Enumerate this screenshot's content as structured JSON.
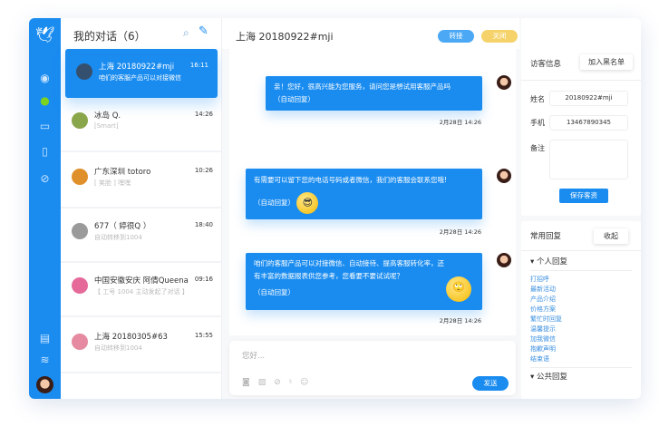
{
  "sidebar": {
    "icons": [
      "bird-logo",
      "weibo",
      "wechat",
      "monitor",
      "mobile",
      "link",
      "notes",
      "layers",
      "avatar"
    ]
  },
  "list": {
    "title": "我的对话（6）",
    "items": [
      {
        "name": "上海 20180922#mji",
        "preview": "咱们的客服产品可以对接微信",
        "time": "16:11",
        "active": true,
        "avatar_color": "#35506e"
      },
      {
        "name": "冰岛 Q.",
        "preview": "[Smart]",
        "time": "14:26",
        "avatar_color": "#8aa64a"
      },
      {
        "name": "广东深圳 totoro",
        "preview": "[ 笑脸 ] 嘿嘿",
        "time": "10:26",
        "avatar_color": "#e0902a"
      },
      {
        "name": "677（ 婷很Q ）",
        "preview": "自动转移到1004",
        "time": "18:40",
        "avatar_color": "#9a9a9a"
      },
      {
        "name": "中国安徽安庆 阿倩Queena",
        "preview": "【 工号 1004 主动发起了对话 】",
        "time": "09:16",
        "avatar_color": "#e56a9a"
      },
      {
        "name": "上海 20180305#63",
        "preview": "自动转移到1004",
        "time": "15:55",
        "avatar_color": "#e58aa0"
      }
    ]
  },
  "chat": {
    "title": "上海 20180922#mji",
    "transfer_label": "转接",
    "close_label": "关闭",
    "messages": [
      {
        "text": "亲！您好，很高兴能为您服务，请问您是想试用客服产品吗",
        "auto": "（自动回复）",
        "time": "2月28日 14:26"
      },
      {
        "text": "有需要可以留下您的电话号码或者微信，我们的客服会联系您哦!",
        "auto": "（自动回复）",
        "time": "2月28日 14:26"
      },
      {
        "text": "咱们的客服产品可以对接微信、自动接待、提高客服转化率，还有丰富的数据报表供您参考，您看要不要试试呢？",
        "auto": "（自动回复）",
        "time": "2月28日 14:26"
      }
    ],
    "input_placeholder": "您好...",
    "send_label": "发送"
  },
  "visitor": {
    "title": "访客信息",
    "blacklist_label": "加入黑名单",
    "name_label": "姓名",
    "name_value": "20180922#mji",
    "phone_label": "手机",
    "phone_value": "13467890345",
    "note_label": "备注",
    "save_label": "保存客资"
  },
  "replies": {
    "title": "常用回复",
    "collapse_label": "收起",
    "personal_label": "个人回复",
    "personal_items": [
      "打招呼",
      "最新活动",
      "产品介绍",
      "价格方案",
      "繁忙时回复",
      "温馨提示",
      "加我微信",
      "抱歉声明",
      "结束语"
    ],
    "public_label": "公共回复"
  },
  "colors": {
    "primary": "#1a8cf0",
    "close": "#f5d36a",
    "transfer": "#4aa8f5"
  }
}
